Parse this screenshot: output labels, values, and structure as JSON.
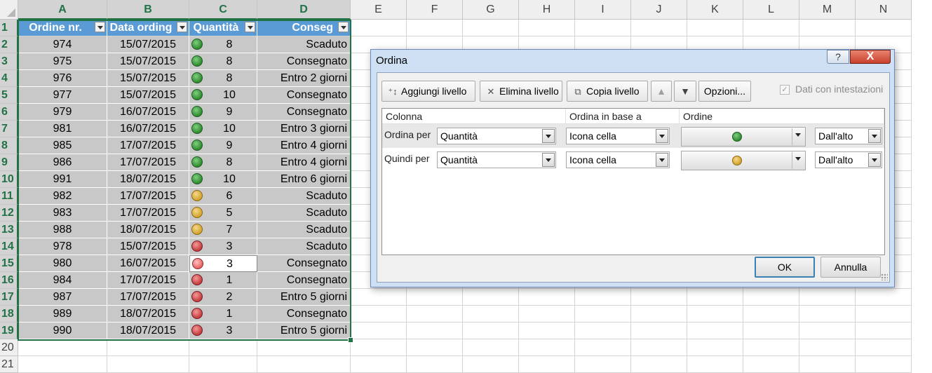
{
  "columns": [
    "A",
    "B",
    "C",
    "D",
    "E",
    "F",
    "G",
    "H",
    "I",
    "J",
    "K",
    "L",
    "M",
    "N"
  ],
  "row_numbers": [
    "1",
    "2",
    "3",
    "4",
    "5",
    "6",
    "7",
    "8",
    "9",
    "10",
    "11",
    "12",
    "13",
    "14",
    "15",
    "16",
    "17",
    "18",
    "19",
    "20",
    "21"
  ],
  "table": {
    "headers": [
      "Ordine nr.",
      "Data ording",
      "Quantità",
      "Conseg"
    ],
    "rows": [
      {
        "ordine": "974",
        "data": "15/07/2015",
        "icon": "green",
        "qta": "8",
        "consegna": "Scaduto"
      },
      {
        "ordine": "975",
        "data": "15/07/2015",
        "icon": "green",
        "qta": "8",
        "consegna": "Consegnato"
      },
      {
        "ordine": "976",
        "data": "15/07/2015",
        "icon": "green",
        "qta": "8",
        "consegna": "Entro 2 giorni"
      },
      {
        "ordine": "977",
        "data": "15/07/2015",
        "icon": "green",
        "qta": "10",
        "consegna": "Consegnato"
      },
      {
        "ordine": "979",
        "data": "16/07/2015",
        "icon": "green",
        "qta": "9",
        "consegna": "Consegnato"
      },
      {
        "ordine": "981",
        "data": "16/07/2015",
        "icon": "green",
        "qta": "10",
        "consegna": "Entro 3 giorni"
      },
      {
        "ordine": "985",
        "data": "17/07/2015",
        "icon": "green",
        "qta": "9",
        "consegna": "Entro 4 giorni"
      },
      {
        "ordine": "986",
        "data": "17/07/2015",
        "icon": "green",
        "qta": "8",
        "consegna": "Entro 4 giorni"
      },
      {
        "ordine": "991",
        "data": "18/07/2015",
        "icon": "green",
        "qta": "10",
        "consegna": "Entro 6 giorni"
      },
      {
        "ordine": "982",
        "data": "17/07/2015",
        "icon": "yellow",
        "qta": "6",
        "consegna": "Scaduto"
      },
      {
        "ordine": "983",
        "data": "17/07/2015",
        "icon": "yellow",
        "qta": "5",
        "consegna": "Scaduto"
      },
      {
        "ordine": "988",
        "data": "18/07/2015",
        "icon": "yellow",
        "qta": "7",
        "consegna": "Scaduto"
      },
      {
        "ordine": "978",
        "data": "15/07/2015",
        "icon": "red",
        "qta": "3",
        "consegna": "Scaduto"
      },
      {
        "ordine": "980",
        "data": "16/07/2015",
        "icon": "lightred",
        "qta": "3",
        "consegna": "Consegnato"
      },
      {
        "ordine": "984",
        "data": "17/07/2015",
        "icon": "red",
        "qta": "1",
        "consegna": "Consegnato"
      },
      {
        "ordine": "987",
        "data": "17/07/2015",
        "icon": "red",
        "qta": "2",
        "consegna": "Entro 5 giorni"
      },
      {
        "ordine": "989",
        "data": "18/07/2015",
        "icon": "red",
        "qta": "1",
        "consegna": "Consegnato"
      },
      {
        "ordine": "990",
        "data": "18/07/2015",
        "icon": "red",
        "qta": "3",
        "consegna": "Entro 5 giorni"
      }
    ]
  },
  "dialog": {
    "title": "Ordina",
    "help_label": "?",
    "close_label": "X",
    "toolbar": {
      "add_level": "Aggiungi livello",
      "delete_level": "Elimina livello",
      "copy_level": "Copia livello",
      "options": "Opzioni...",
      "headers_checkbox": "Dati con intestazioni"
    },
    "grid_headers": {
      "column": "Colonna",
      "sort_on": "Ordina in base a",
      "order": "Ordine"
    },
    "levels": [
      {
        "label": "Ordina per",
        "column": "Quantità",
        "sort_on": "Icona cella",
        "order_icon": "green",
        "direction": "Dall'alto"
      },
      {
        "label": "Quindi per",
        "column": "Quantità",
        "sort_on": "Icona cella",
        "order_icon": "yellow",
        "direction": "Dall'alto"
      }
    ],
    "ok": "OK",
    "cancel": "Annulla"
  },
  "colors": {
    "header_blue": "#5b9bd5",
    "excel_green": "#217346",
    "icon_green": "#2e8b2e",
    "icon_yellow": "#d4a22c",
    "icon_red": "#c43c3c"
  }
}
